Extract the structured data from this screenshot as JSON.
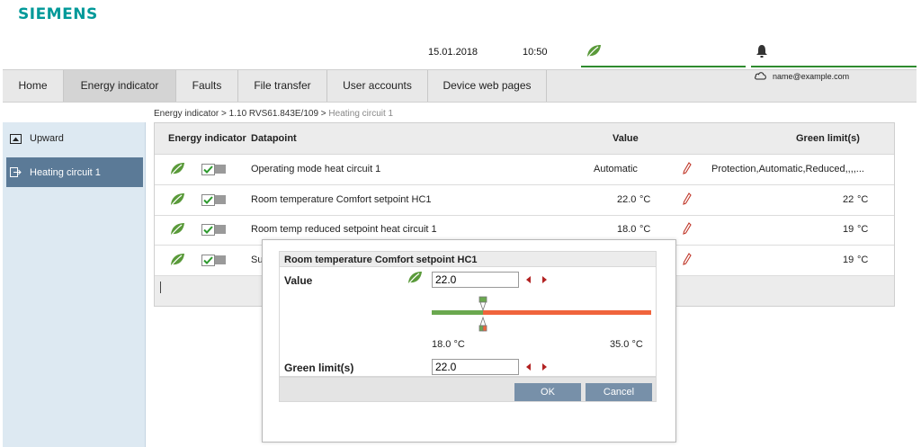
{
  "brand": {
    "logo": "SIEMENS",
    "accent": "#009999"
  },
  "status": {
    "date": "15.01.2018",
    "time": "10:50",
    "energy_icon": "leaf-icon",
    "alarm_icon": "bell-icon",
    "status_color": "#2e8b2e"
  },
  "user": {
    "email": "name@example.com",
    "icon": "cloud-icon"
  },
  "nav": {
    "items": [
      {
        "label": "Home"
      },
      {
        "label": "Energy indicator",
        "active": true
      },
      {
        "label": "Faults"
      },
      {
        "label": "File transfer"
      },
      {
        "label": "User accounts"
      },
      {
        "label": "Device web pages"
      }
    ]
  },
  "breadcrumb": {
    "part1": "Energy indicator",
    "sep": ">",
    "part2": "1.10 RVS61.843E/109",
    "current": "Heating circuit 1"
  },
  "sidebar": {
    "items": [
      {
        "label": "Upward",
        "icon": "upward-icon"
      },
      {
        "label": "Heating circuit 1",
        "icon": "enter-icon",
        "active": true
      }
    ]
  },
  "table": {
    "headers": {
      "energy": "Energy indicator",
      "datapoint": "Datapoint",
      "value": "Value",
      "limit": "Green limit(s)"
    },
    "rows": [
      {
        "datapoint": "Operating mode heat circuit 1",
        "value": "Automatic",
        "unit": "",
        "limit": "Protection,Automatic,Reduced,,,,...",
        "limit_unit": ""
      },
      {
        "datapoint": "Room temperature Comfort setpoint HC1",
        "value": "22.0",
        "unit": "°C",
        "limit": "22",
        "limit_unit": "°C"
      },
      {
        "datapoint": "Room temp reduced setpoint heat circuit 1",
        "value": "18.0",
        "unit": "°C",
        "limit": "19",
        "limit_unit": "°C"
      },
      {
        "datapoint": "Su",
        "value": "",
        "unit": "",
        "limit": "19",
        "limit_unit": "°C"
      }
    ]
  },
  "dialog": {
    "title": "Room temperature Comfort setpoint HC1",
    "value_label": "Value",
    "value": "22.0",
    "min": "18.0 °C",
    "max": "35.0 °C",
    "limit_label": "Green limit(s)",
    "limit_value": "22.0",
    "ok": "OK",
    "cancel": "Cancel",
    "value_fraction": 0.235
  }
}
